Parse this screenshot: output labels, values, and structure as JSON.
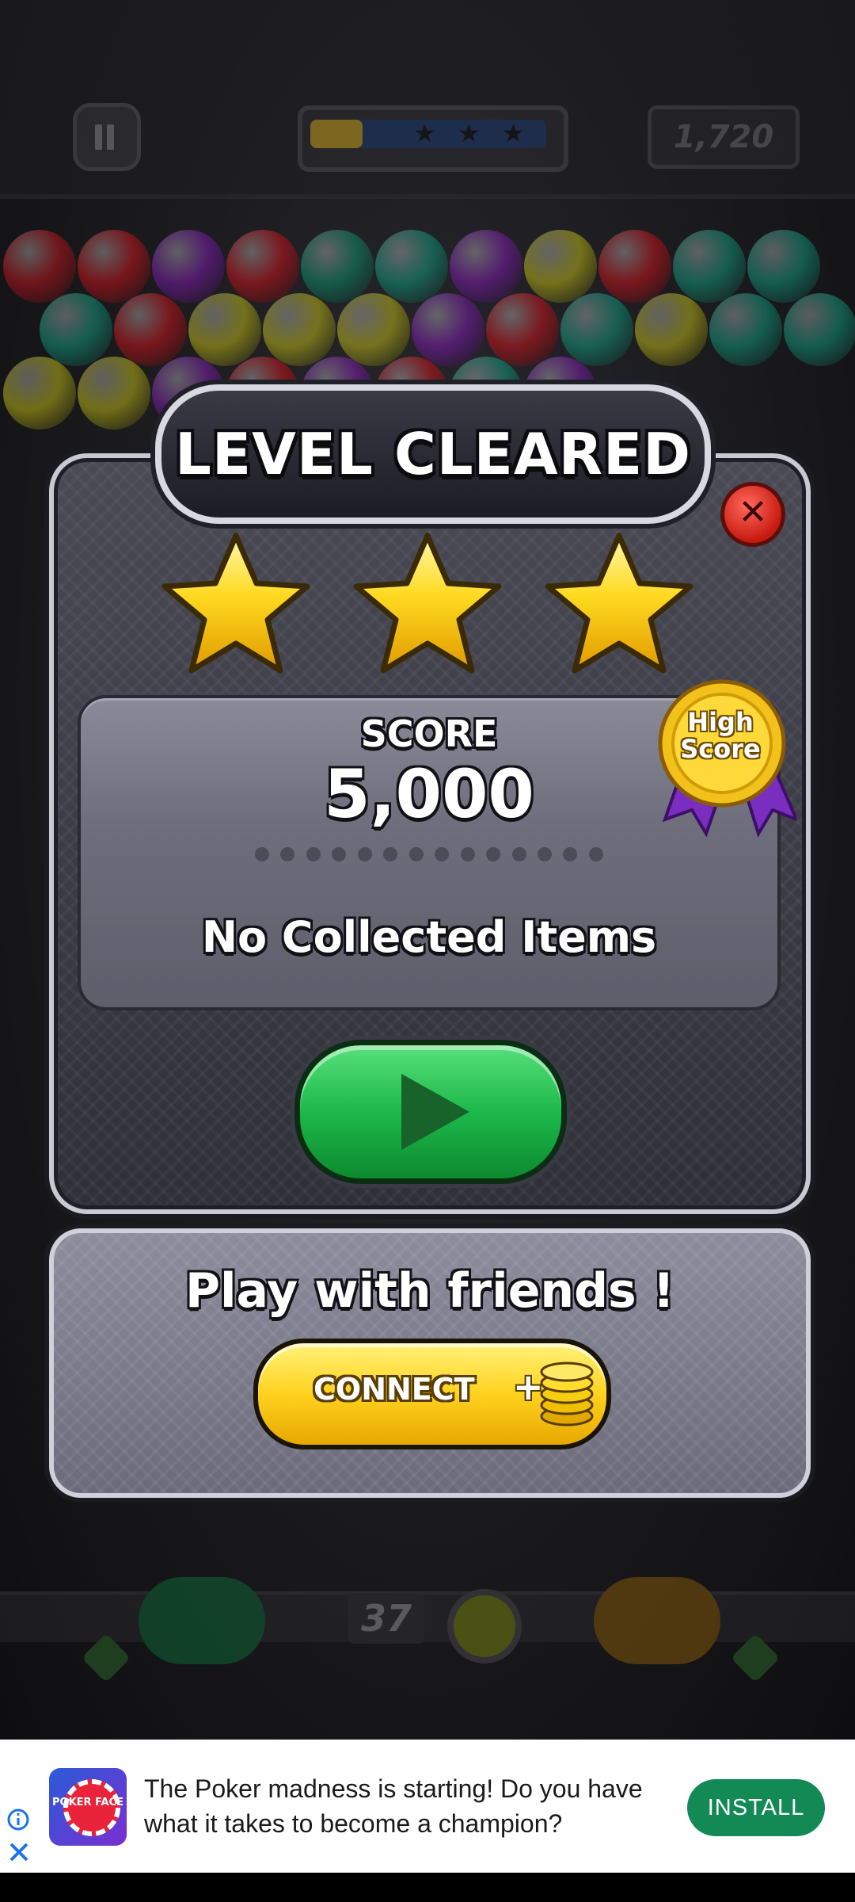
{
  "hud": {
    "score": "1,720",
    "progress_fraction": 0.22,
    "stars_earned": 3
  },
  "dialog": {
    "title": "LEVEL CLEARED !",
    "stars": 3,
    "score_label": "SCORE",
    "score_value": "5,000",
    "badge_text": "High Score",
    "collected_text": "No Collected Items"
  },
  "friends": {
    "title": "Play with friends !",
    "connect_label": "CONNECT",
    "connect_plus": "+"
  },
  "launcher": {
    "shots_left": "37"
  },
  "ad": {
    "logo_text": "POKER FACE",
    "text": "The Poker madness is starting! Do you have what it takes to become a champion?",
    "install_label": "INSTALL"
  },
  "colors": {
    "accent_green": "#1db94a",
    "star_gold": "#ffd21f",
    "install_green": "#138a55",
    "close_red": "#c8190f"
  },
  "bubbles": [
    {
      "c": "#b8141c"
    },
    {
      "c": "#c4121a"
    },
    {
      "c": "#7a1aa8"
    },
    {
      "c": "#c4121a"
    },
    {
      "c": "#0e8a6a"
    },
    {
      "c": "#12957a"
    },
    {
      "c": "#7a1aa8"
    },
    {
      "c": "#b9b415"
    },
    {
      "c": "#c4121a"
    },
    {
      "c": "#12957a"
    },
    {
      "c": "#12957a"
    },
    {
      "c": "#12957a"
    },
    {
      "c": "#c4121a"
    },
    {
      "c": "#b9b415"
    },
    {
      "c": "#b9b415"
    },
    {
      "c": "#b9b415"
    },
    {
      "c": "#7a1aa8"
    },
    {
      "c": "#c4121a"
    },
    {
      "c": "#12957a"
    },
    {
      "c": "#b9b415"
    },
    {
      "c": "#12957a"
    },
    {
      "c": "#12957a"
    },
    {
      "c": "#b9b415"
    },
    {
      "c": "#b9b415"
    },
    {
      "c": "#7a1aa8"
    },
    {
      "c": "#c4121a"
    },
    {
      "c": "#7a1aa8"
    },
    {
      "c": "#c4121a"
    },
    {
      "c": "#12957a"
    },
    {
      "c": "#7a1aa8"
    }
  ]
}
